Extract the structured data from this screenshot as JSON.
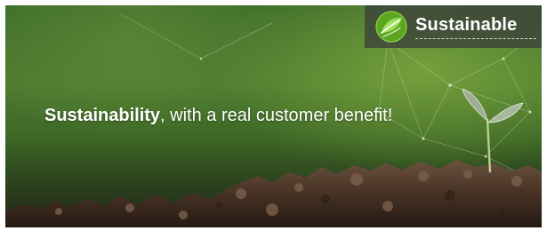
{
  "banner": {
    "headline_bold": "Sustainability",
    "headline_rest": ", with a real customer benefit!",
    "badge_label": "Sustainable",
    "badge_icon": "leaf-logo-icon",
    "colors": {
      "background_green": "#4d7c30",
      "soil_brown": "#4a3526",
      "badge_background": "#3c423a",
      "logo_green": "#6fbf2a",
      "text": "#ffffff"
    }
  }
}
